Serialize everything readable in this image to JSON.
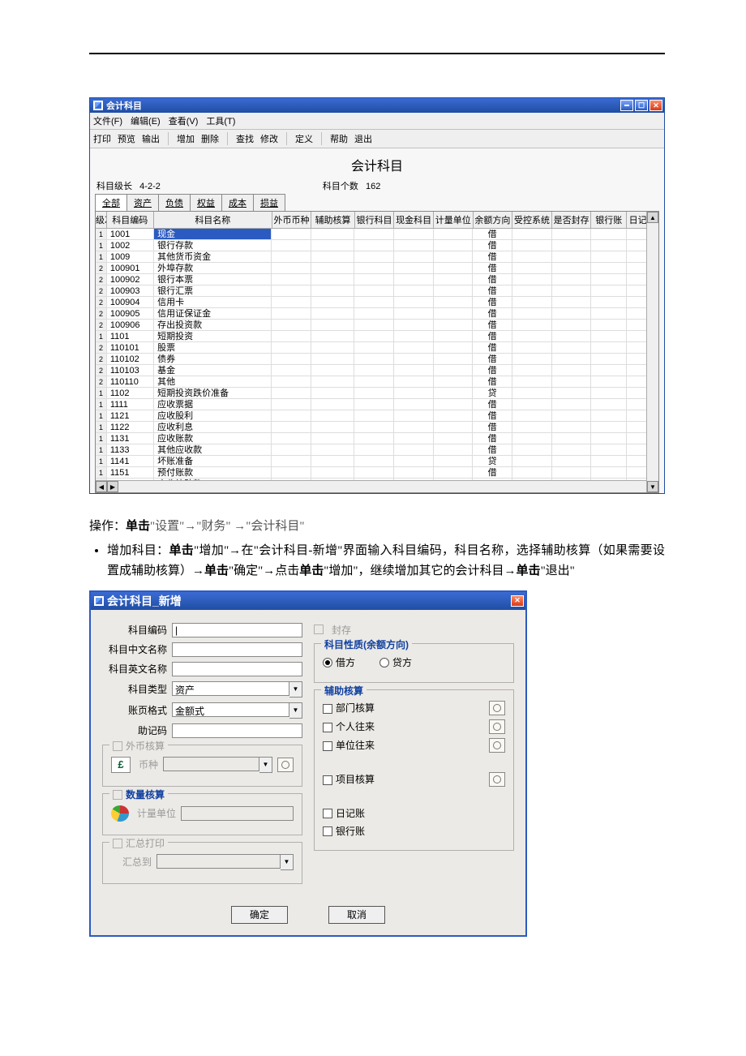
{
  "window1": {
    "title": "会计科目",
    "menus": [
      "文件(F)",
      "编辑(E)",
      "查看(V)",
      "工具(T)"
    ],
    "toolbar": [
      "打印",
      "预览",
      "输出",
      "|",
      "增加",
      "删除",
      "|",
      "查找",
      "修改",
      "|",
      "定义",
      "|",
      "帮助",
      "退出"
    ],
    "heading": "会计科目",
    "info_len_label": "科目级长",
    "info_len_value": "4-2-2",
    "info_count_label": "科目个数",
    "info_count_value": "162",
    "tabs": [
      "全部",
      "资产",
      "负债",
      "权益",
      "成本",
      "损益"
    ],
    "columns": {
      "lvl": "级次",
      "code": "科目编码",
      "name": "科目名称",
      "curr": "外币币种",
      "aux": "辅助核算",
      "bank": "银行科目",
      "cash": "现金科目",
      "unit": "计量单位",
      "dir": "余额方向",
      "sys": "受控系统",
      "seal": "是否封存",
      "bankacct": "银行账",
      "diary": "日记账"
    },
    "rows": [
      {
        "lvl": "1",
        "code": "1001",
        "name": "现金",
        "dir": "借",
        "sel": true
      },
      {
        "lvl": "1",
        "code": "1002",
        "name": "银行存款",
        "dir": "借"
      },
      {
        "lvl": "1",
        "code": "1009",
        "name": "其他货币资金",
        "dir": "借"
      },
      {
        "lvl": "2",
        "code": "100901",
        "name": "外埠存款",
        "dir": "借"
      },
      {
        "lvl": "2",
        "code": "100902",
        "name": "银行本票",
        "dir": "借"
      },
      {
        "lvl": "2",
        "code": "100903",
        "name": "银行汇票",
        "dir": "借"
      },
      {
        "lvl": "2",
        "code": "100904",
        "name": "信用卡",
        "dir": "借"
      },
      {
        "lvl": "2",
        "code": "100905",
        "name": "信用证保证金",
        "dir": "借"
      },
      {
        "lvl": "2",
        "code": "100906",
        "name": "存出投资款",
        "dir": "借"
      },
      {
        "lvl": "1",
        "code": "1101",
        "name": "短期投资",
        "dir": "借"
      },
      {
        "lvl": "2",
        "code": "110101",
        "name": "股票",
        "dir": "借"
      },
      {
        "lvl": "2",
        "code": "110102",
        "name": "债券",
        "dir": "借"
      },
      {
        "lvl": "2",
        "code": "110103",
        "name": "基金",
        "dir": "借"
      },
      {
        "lvl": "2",
        "code": "110110",
        "name": "其他",
        "dir": "借"
      },
      {
        "lvl": "1",
        "code": "1102",
        "name": "短期投资跌价准备",
        "dir": "贷"
      },
      {
        "lvl": "1",
        "code": "1111",
        "name": "应收票据",
        "dir": "借"
      },
      {
        "lvl": "1",
        "code": "1121",
        "name": "应收股利",
        "dir": "借"
      },
      {
        "lvl": "1",
        "code": "1122",
        "name": "应收利息",
        "dir": "借"
      },
      {
        "lvl": "1",
        "code": "1131",
        "name": "应收账款",
        "dir": "借"
      },
      {
        "lvl": "1",
        "code": "1133",
        "name": "其他应收款",
        "dir": "借"
      },
      {
        "lvl": "1",
        "code": "1141",
        "name": "坏账准备",
        "dir": "贷"
      },
      {
        "lvl": "1",
        "code": "1151",
        "name": "预付账款",
        "dir": "借"
      },
      {
        "lvl": "",
        "code": "",
        "name": "应收补贴款",
        "dir": "…"
      }
    ]
  },
  "instruction": {
    "line1_prefix": "操作：",
    "line1_bold": "单击",
    "line1_rest": "\"设置\"→\"财务\" →\"会计科目\"",
    "bullet_parts": [
      {
        "t": "增加科目：",
        "b": false
      },
      {
        "t": "单击",
        "b": true
      },
      {
        "t": "\"增加\"→在\"会计科目-新增\"界面输入科目编码，科目名称，选择辅助核算（如果需要设置成辅助核算）→",
        "b": false
      },
      {
        "t": "单击",
        "b": true
      },
      {
        "t": "\"确定\"→点击",
        "b": false
      },
      {
        "t": "单击",
        "b": true
      },
      {
        "t": "\"增加\"，继续增加其它的会计科目→",
        "b": false
      },
      {
        "t": "单击",
        "b": true
      },
      {
        "t": "\"退出\"",
        "b": false
      }
    ]
  },
  "dialog": {
    "title": "会计科目_新增",
    "labels": {
      "code": "科目编码",
      "cname": "科目中文名称",
      "ename": "科目英文名称",
      "type": "科目类型",
      "page": "账页格式",
      "mnemonic": "助记码",
      "type_value": "资产",
      "page_value": "金额式",
      "fx_group": "外币核算",
      "fx_curr": "币种",
      "qty_group": "数量核算",
      "qty_unit": "计量单位",
      "sum_group": "汇总打印",
      "sum_to": "汇总到",
      "seal": "封存",
      "nature_group": "科目性质(余额方向)",
      "debit": "借方",
      "credit": "贷方",
      "aux_group": "辅助核算",
      "aux_dept": "部门核算",
      "aux_person": "个人往来",
      "aux_unit": "单位往来",
      "aux_proj": "项目核算",
      "diary": "日记账",
      "bank": "银行账",
      "ok": "确定",
      "cancel": "取消"
    }
  }
}
